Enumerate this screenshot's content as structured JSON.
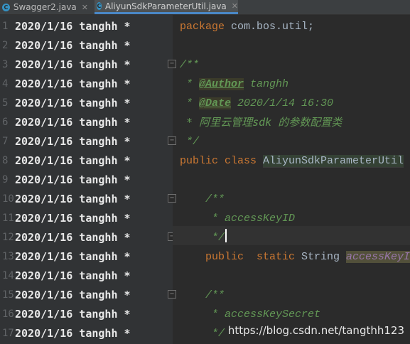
{
  "tabs": [
    {
      "label": "Swagger2.java",
      "active": false
    },
    {
      "label": "AliyunSdkParameterUtil.java",
      "active": true
    }
  ],
  "colors": {
    "accent": "#4a88c7",
    "keyword": "#cc7832",
    "comment": "#629755",
    "field": "#9876aa"
  },
  "gutter": {
    "annotations": [
      {
        "line": "1",
        "text": "2020/1/16 tanghh *"
      },
      {
        "line": "2",
        "text": "2020/1/16 tanghh *"
      },
      {
        "line": "3",
        "text": "2020/1/16 tanghh *"
      },
      {
        "line": "4",
        "text": "2020/1/16 tanghh *"
      },
      {
        "line": "5",
        "text": "2020/1/16 tanghh *"
      },
      {
        "line": "6",
        "text": "2020/1/16 tanghh *"
      },
      {
        "line": "7",
        "text": "2020/1/16 tanghh *"
      },
      {
        "line": "8",
        "text": "2020/1/16 tanghh *"
      },
      {
        "line": "9",
        "text": "2020/1/16 tanghh *"
      },
      {
        "line": "10",
        "text": "2020/1/16 tanghh *"
      },
      {
        "line": "11",
        "text": "2020/1/16 tanghh *"
      },
      {
        "line": "12",
        "text": "2020/1/16 tanghh *"
      },
      {
        "line": "13",
        "text": "2020/1/16 tanghh *"
      },
      {
        "line": "14",
        "text": "2020/1/16 tanghh *"
      },
      {
        "line": "15",
        "text": "2020/1/16 tanghh *"
      },
      {
        "line": "16",
        "text": "2020/1/16 tanghh *"
      },
      {
        "line": "17",
        "text": "2020/1/16 tanghh *"
      }
    ]
  },
  "code": {
    "l1_kw": "package",
    "l1_rest": " com.bos.util;",
    "l3": "/**",
    "l4_star": " * ",
    "l4_tag": "@Author",
    "l4_val": " tanghh",
    "l5_star": " * ",
    "l5_tag": "@Date",
    "l5_val": " 2020/1/14 16:30",
    "l6": " * 阿里云管理sdk 的参数配置类",
    "l7": " */",
    "l8_kw": "public class ",
    "l8_name": "AliyunSdkParameterUtil",
    "l10": "/**",
    "l11": " * accessKeyID",
    "l12": " */",
    "l13_kw1": "public",
    "l13_kw2": "  static",
    "l13_type": " String ",
    "l13_field": "accessKeyI",
    "l15": "/**",
    "l16": " * accessKeySecret",
    "l17": " */"
  },
  "watermark": "https://blog.csdn.net/tangthh123"
}
